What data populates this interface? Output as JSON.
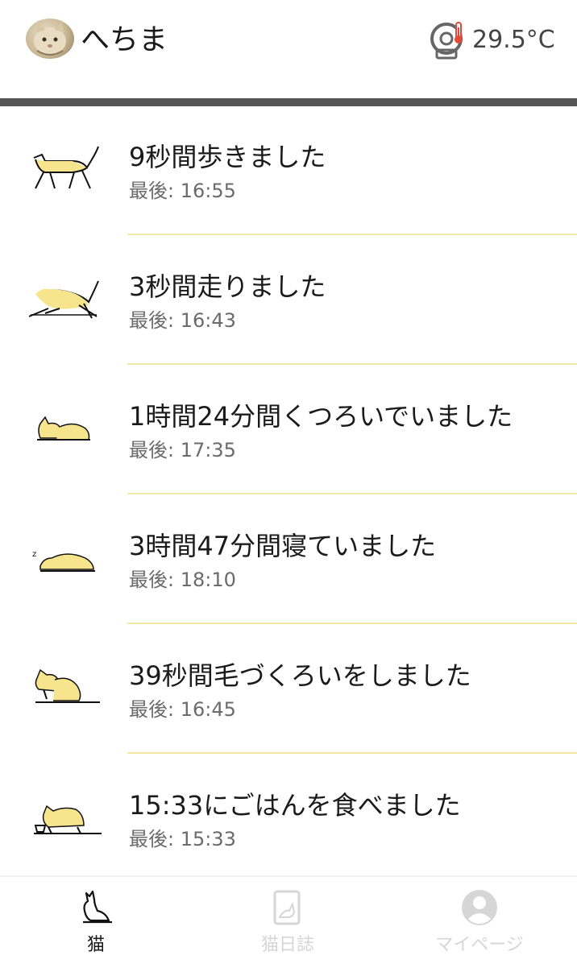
{
  "header": {
    "cat_name": "へちま",
    "temperature": "29.5°C",
    "device_icon": "thermometer-device-icon"
  },
  "activities": [
    {
      "icon": "cat-walking-icon",
      "title": "9秒間歩きました",
      "last": "最後: 16:55"
    },
    {
      "icon": "cat-running-icon",
      "title": "3秒間走りました",
      "last": "最後: 16:43"
    },
    {
      "icon": "cat-relaxing-icon",
      "title": "1時間24分間くつろいでいました",
      "last": "最後: 17:35"
    },
    {
      "icon": "cat-sleeping-icon",
      "title": "3時間47分間寝ていました",
      "last": "最後: 18:10"
    },
    {
      "icon": "cat-grooming-icon",
      "title": "39秒間毛づくろいをしました",
      "last": "最後: 16:45"
    },
    {
      "icon": "cat-eating-icon",
      "title": "15:33にごはんを食べました",
      "last": "最後: 15:33"
    }
  ],
  "bottom_nav": [
    {
      "icon": "cat-icon",
      "label": "猫",
      "active": true
    },
    {
      "icon": "diary-icon",
      "label": "猫日誌",
      "active": false
    },
    {
      "icon": "profile-icon",
      "label": "マイページ",
      "active": false
    }
  ],
  "colors": {
    "accent_yellow": "#f6e58d",
    "divider": "#f3e9a6",
    "header_bar": "#555555",
    "inactive_nav": "#d6d6d6",
    "thermometer_red": "#e04a3a"
  }
}
